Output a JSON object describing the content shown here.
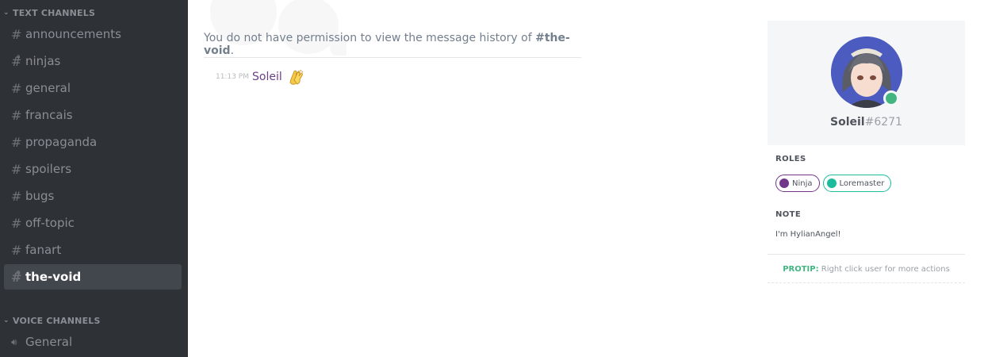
{
  "sidebar": {
    "text_category": "TEXT CHANNELS",
    "voice_category": "VOICE CHANNELS",
    "text_channels": [
      {
        "name": "announcements",
        "locked": false
      },
      {
        "name": "ninjas",
        "locked": true
      },
      {
        "name": "general",
        "locked": false
      },
      {
        "name": "francais",
        "locked": false
      },
      {
        "name": "propaganda",
        "locked": false
      },
      {
        "name": "spoilers",
        "locked": false
      },
      {
        "name": "bugs",
        "locked": false
      },
      {
        "name": "off-topic",
        "locked": false
      },
      {
        "name": "fanart",
        "locked": false
      },
      {
        "name": "the-void",
        "locked": true,
        "active": true
      }
    ],
    "voice_channels": [
      {
        "name": "General"
      }
    ]
  },
  "main": {
    "notice_prefix": "You do not have permission to view the message history of ",
    "notice_channel": "#the-void",
    "notice_suffix": ".",
    "message": {
      "time": "11:13 PM",
      "author": "Soleil",
      "emoji": "clapping-hands"
    }
  },
  "profile": {
    "username": "Soleil",
    "discriminator": "#6271",
    "status_color": "#43b581",
    "roles_title": "ROLES",
    "roles": [
      {
        "name": "Ninja",
        "color": "#71368a"
      },
      {
        "name": "Loremaster",
        "color": "#1abc9c"
      }
    ],
    "note_title": "NOTE",
    "note_text": "I'm HylianAngel!",
    "protip_label": "PROTIP:",
    "protip_text": " Right click user for more actions"
  }
}
